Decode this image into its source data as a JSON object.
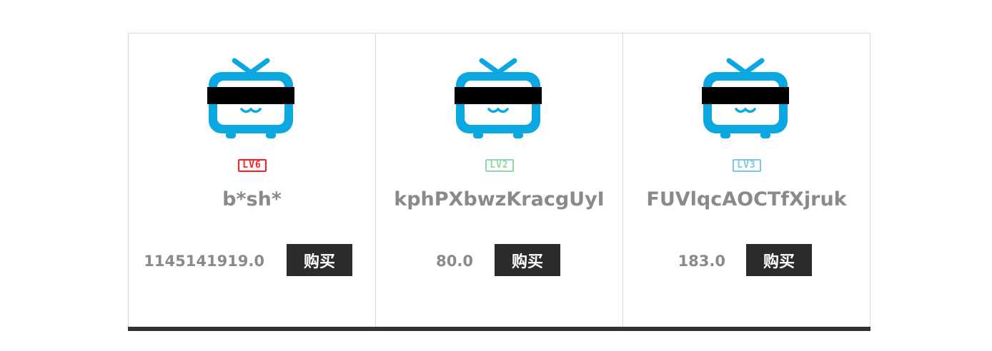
{
  "avatar": {
    "icon": "tv-mascot-icon",
    "color": "#0ba7e0"
  },
  "cards": [
    {
      "level": "LV6",
      "level_color": "#ff1e1e",
      "username": "b*sh*",
      "price": "1145141919.0",
      "buy_label": "购买"
    },
    {
      "level": "LV2",
      "level_color": "#8fd9a8",
      "username": "kphPXbwzKracgUyI",
      "price": "80.0",
      "buy_label": "购买"
    },
    {
      "level": "LV3",
      "level_color": "#7cc7e6",
      "username": "FUVlqcAOCTfXjruk",
      "price": "183.0",
      "buy_label": "购买"
    }
  ]
}
